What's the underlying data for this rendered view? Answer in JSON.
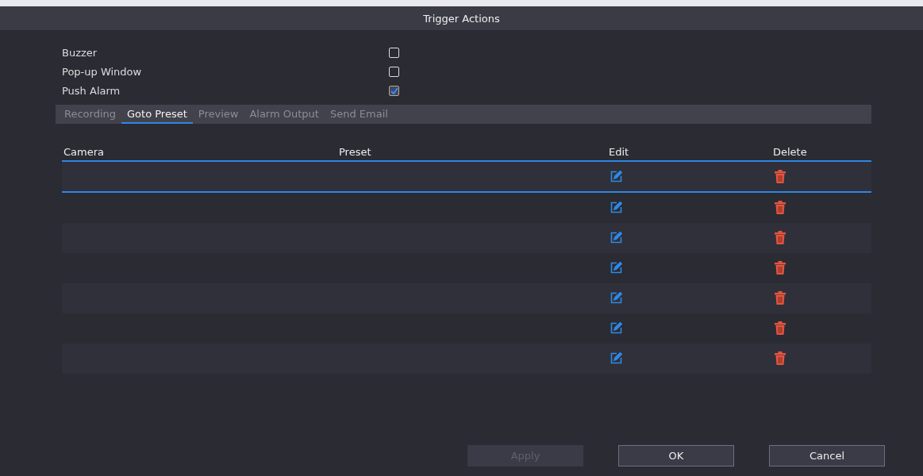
{
  "window": {
    "title": "Trigger Actions"
  },
  "options": [
    {
      "label": "Buzzer",
      "checked": false
    },
    {
      "label": "Pop-up Window",
      "checked": false
    },
    {
      "label": "Push Alarm",
      "checked": true
    }
  ],
  "tabs": [
    {
      "label": "Recording",
      "selected": false
    },
    {
      "label": "Goto Preset",
      "selected": true
    },
    {
      "label": "Preview",
      "selected": false
    },
    {
      "label": "Alarm Output",
      "selected": false
    },
    {
      "label": "Send Email",
      "selected": false
    }
  ],
  "table": {
    "columns": [
      "Camera",
      "Preset",
      "Edit",
      "Delete"
    ],
    "rows": [
      {
        "selected": true
      },
      {
        "selected": false
      },
      {
        "selected": false
      },
      {
        "selected": false
      },
      {
        "selected": false
      },
      {
        "selected": false
      },
      {
        "selected": false
      }
    ]
  },
  "buttons": [
    {
      "label": "Apply",
      "disabled": true
    },
    {
      "label": "OK",
      "disabled": false
    },
    {
      "label": "Cancel",
      "disabled": false
    }
  ]
}
